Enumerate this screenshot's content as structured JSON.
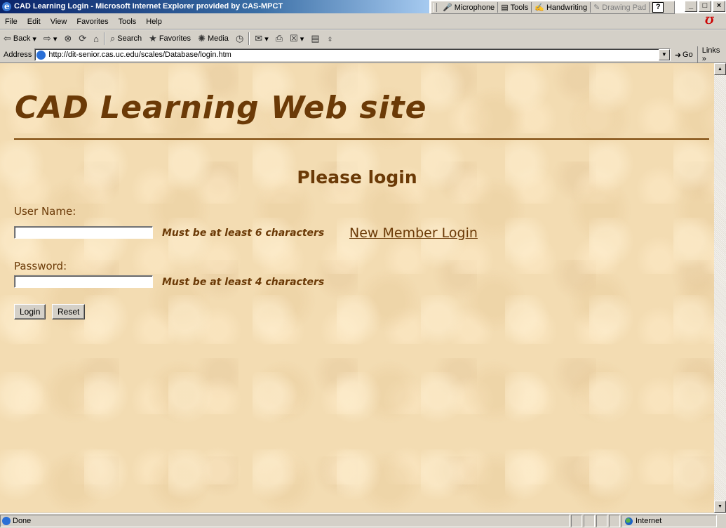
{
  "window": {
    "title": "CAD Learning Login - Microsoft Internet Explorer provided by CAS-MPCT",
    "controls": [
      "_",
      "□",
      "×"
    ]
  },
  "language_bar": {
    "items": [
      "Microphone",
      "Tools",
      "Handwriting",
      "Drawing Pad"
    ],
    "help": "?"
  },
  "menu": {
    "items": [
      "File",
      "Edit",
      "View",
      "Favorites",
      "Tools",
      "Help"
    ]
  },
  "toolbar": {
    "back": "Back",
    "search": "Search",
    "favorites": "Favorites",
    "media": "Media"
  },
  "address": {
    "label": "Address",
    "url": "http://dit-senior.cas.uc.edu/scales/Database/login.htm",
    "go": "Go",
    "links": "Links »"
  },
  "page": {
    "site_title": "CAD Learning Web site",
    "subtitle": "Please login",
    "username_label": "User Name:",
    "username_value": "",
    "username_hint": "Must be at least 6 characters",
    "new_member_link": "New Member Login",
    "password_label": "Password:",
    "password_value": "",
    "password_hint": "Must be at least 4 characters",
    "login_button": "Login",
    "reset_button": "Reset"
  },
  "status": {
    "text": "Done",
    "zone": "Internet"
  },
  "colors": {
    "text_brown": "#6b3a07",
    "background_parchment": "#f3dcb2"
  }
}
